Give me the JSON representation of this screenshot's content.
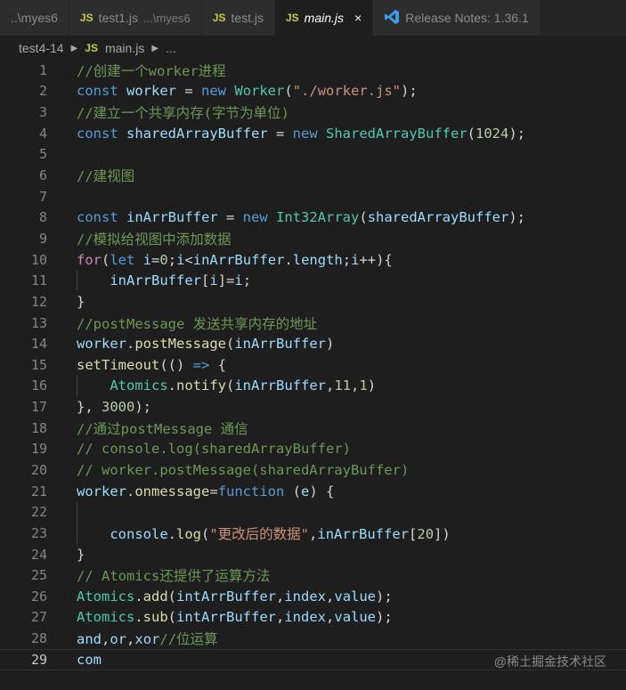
{
  "tabs": [
    {
      "name": "..\\myes6",
      "desc": "",
      "icon": "",
      "active": false
    },
    {
      "name": "test1.js",
      "desc": "...\\myes6",
      "icon": "JS",
      "active": false
    },
    {
      "name": "test.js",
      "desc": "",
      "icon": "JS",
      "active": false
    },
    {
      "name": "main.js",
      "desc": "",
      "icon": "JS",
      "active": true,
      "close": "×"
    },
    {
      "name": "Release Notes: 1.36.1",
      "desc": "",
      "icon": "vscode-icon",
      "active": false
    }
  ],
  "breadcrumb": {
    "folder": "test4-14",
    "file_icon": "JS",
    "file": "main.js",
    "more": "..."
  },
  "lines": [
    [
      [
        "c-comment",
        "//创建一个worker进程"
      ]
    ],
    [
      [
        "c-kw",
        "const"
      ],
      [
        "c-plain",
        " "
      ],
      [
        "c-var",
        "worker"
      ],
      [
        "c-plain",
        " = "
      ],
      [
        "c-kw",
        "new"
      ],
      [
        "c-plain",
        " "
      ],
      [
        "c-type",
        "Worker"
      ],
      [
        "c-plain",
        "("
      ],
      [
        "c-str",
        "\"./worker.js\""
      ],
      [
        "c-plain",
        ");"
      ]
    ],
    [
      [
        "c-comment",
        "//建立一个共享内存(字节为单位)"
      ]
    ],
    [
      [
        "c-kw",
        "const"
      ],
      [
        "c-plain",
        " "
      ],
      [
        "c-var",
        "sharedArrayBuffer"
      ],
      [
        "c-plain",
        " = "
      ],
      [
        "c-kw",
        "new"
      ],
      [
        "c-plain",
        " "
      ],
      [
        "c-type",
        "SharedArrayBuffer"
      ],
      [
        "c-plain",
        "("
      ],
      [
        "c-num",
        "1024"
      ],
      [
        "c-plain",
        ");"
      ]
    ],
    [],
    [
      [
        "c-comment",
        "//建视图"
      ]
    ],
    [],
    [
      [
        "c-kw",
        "const"
      ],
      [
        "c-plain",
        " "
      ],
      [
        "c-var",
        "inArrBuffer"
      ],
      [
        "c-plain",
        " = "
      ],
      [
        "c-kw",
        "new"
      ],
      [
        "c-plain",
        " "
      ],
      [
        "c-type",
        "Int32Array"
      ],
      [
        "c-plain",
        "("
      ],
      [
        "c-var",
        "sharedArrayBuffer"
      ],
      [
        "c-plain",
        ");"
      ]
    ],
    [
      [
        "c-comment",
        "//模拟给视图中添加数据"
      ]
    ],
    [
      [
        "c-ctrl",
        "for"
      ],
      [
        "c-plain",
        "("
      ],
      [
        "c-kw",
        "let"
      ],
      [
        "c-plain",
        " "
      ],
      [
        "c-var",
        "i"
      ],
      [
        "c-plain",
        "="
      ],
      [
        "c-num",
        "0"
      ],
      [
        "c-plain",
        ";"
      ],
      [
        "c-var",
        "i"
      ],
      [
        "c-plain",
        "<"
      ],
      [
        "c-var",
        "inArrBuffer"
      ],
      [
        "c-plain",
        "."
      ],
      [
        "c-var",
        "length"
      ],
      [
        "c-plain",
        ";"
      ],
      [
        "c-var",
        "i"
      ],
      [
        "c-plain",
        "++){"
      ]
    ],
    [
      [
        "c-plain",
        "    "
      ],
      [
        "c-var",
        "inArrBuffer"
      ],
      [
        "c-plain",
        "["
      ],
      [
        "c-var",
        "i"
      ],
      [
        "c-plain",
        "]="
      ],
      [
        "c-var",
        "i"
      ],
      [
        "c-plain",
        ";"
      ]
    ],
    [
      [
        "c-plain",
        "}"
      ]
    ],
    [
      [
        "c-comment",
        "//postMessage 发送共享内存的地址"
      ]
    ],
    [
      [
        "c-var",
        "worker"
      ],
      [
        "c-plain",
        "."
      ],
      [
        "c-fn",
        "postMessage"
      ],
      [
        "c-plain",
        "("
      ],
      [
        "c-var",
        "inArrBuffer"
      ],
      [
        "c-plain",
        ")"
      ]
    ],
    [
      [
        "c-fn",
        "setTimeout"
      ],
      [
        "c-plain",
        "(() "
      ],
      [
        "c-kw",
        "=>"
      ],
      [
        "c-plain",
        " {"
      ]
    ],
    [
      [
        "c-plain",
        "    "
      ],
      [
        "c-type",
        "Atomics"
      ],
      [
        "c-plain",
        "."
      ],
      [
        "c-fn",
        "notify"
      ],
      [
        "c-plain",
        "("
      ],
      [
        "c-var",
        "inArrBuffer"
      ],
      [
        "c-plain",
        ","
      ],
      [
        "c-num",
        "11"
      ],
      [
        "c-plain",
        ","
      ],
      [
        "c-num",
        "1"
      ],
      [
        "c-plain",
        ")"
      ]
    ],
    [
      [
        "c-plain",
        "}, "
      ],
      [
        "c-num",
        "3000"
      ],
      [
        "c-plain",
        ");"
      ]
    ],
    [
      [
        "c-comment",
        "//通过postMessage 通信"
      ]
    ],
    [
      [
        "c-comment",
        "// console.log(sharedArrayBuffer)"
      ]
    ],
    [
      [
        "c-comment",
        "// worker.postMessage(sharedArrayBuffer)"
      ]
    ],
    [
      [
        "c-var",
        "worker"
      ],
      [
        "c-plain",
        "."
      ],
      [
        "c-fn",
        "onmessage"
      ],
      [
        "c-plain",
        "="
      ],
      [
        "c-kw",
        "function"
      ],
      [
        "c-plain",
        " ("
      ],
      [
        "c-var",
        "e"
      ],
      [
        "c-plain",
        ") {"
      ]
    ],
    [],
    [
      [
        "c-plain",
        "    "
      ],
      [
        "c-var",
        "console"
      ],
      [
        "c-plain",
        "."
      ],
      [
        "c-fn",
        "log"
      ],
      [
        "c-plain",
        "("
      ],
      [
        "c-str",
        "\"更改后的数据\""
      ],
      [
        "c-plain",
        ","
      ],
      [
        "c-var",
        "inArrBuffer"
      ],
      [
        "c-plain",
        "["
      ],
      [
        "c-num",
        "20"
      ],
      [
        "c-plain",
        "])"
      ]
    ],
    [
      [
        "c-plain",
        "}"
      ]
    ],
    [
      [
        "c-comment",
        "// Atomics还提供了运算方法"
      ]
    ],
    [
      [
        "c-type",
        "Atomics"
      ],
      [
        "c-plain",
        "."
      ],
      [
        "c-fn",
        "add"
      ],
      [
        "c-plain",
        "("
      ],
      [
        "c-var",
        "intArrBuffer"
      ],
      [
        "c-plain",
        ","
      ],
      [
        "c-var",
        "index"
      ],
      [
        "c-plain",
        ","
      ],
      [
        "c-var",
        "value"
      ],
      [
        "c-plain",
        ");"
      ]
    ],
    [
      [
        "c-type",
        "Atomics"
      ],
      [
        "c-plain",
        "."
      ],
      [
        "c-fn",
        "sub"
      ],
      [
        "c-plain",
        "("
      ],
      [
        "c-var",
        "intArrBuffer"
      ],
      [
        "c-plain",
        ","
      ],
      [
        "c-var",
        "index"
      ],
      [
        "c-plain",
        ","
      ],
      [
        "c-var",
        "value"
      ],
      [
        "c-plain",
        ");"
      ]
    ],
    [
      [
        "c-var",
        "and"
      ],
      [
        "c-plain",
        ","
      ],
      [
        "c-var",
        "or"
      ],
      [
        "c-plain",
        ","
      ],
      [
        "c-var",
        "xor"
      ],
      [
        "c-comment",
        "//位运算"
      ]
    ],
    [
      [
        "c-var",
        "com"
      ]
    ]
  ],
  "current_line": 29,
  "watermark": "@稀土掘金技术社区"
}
